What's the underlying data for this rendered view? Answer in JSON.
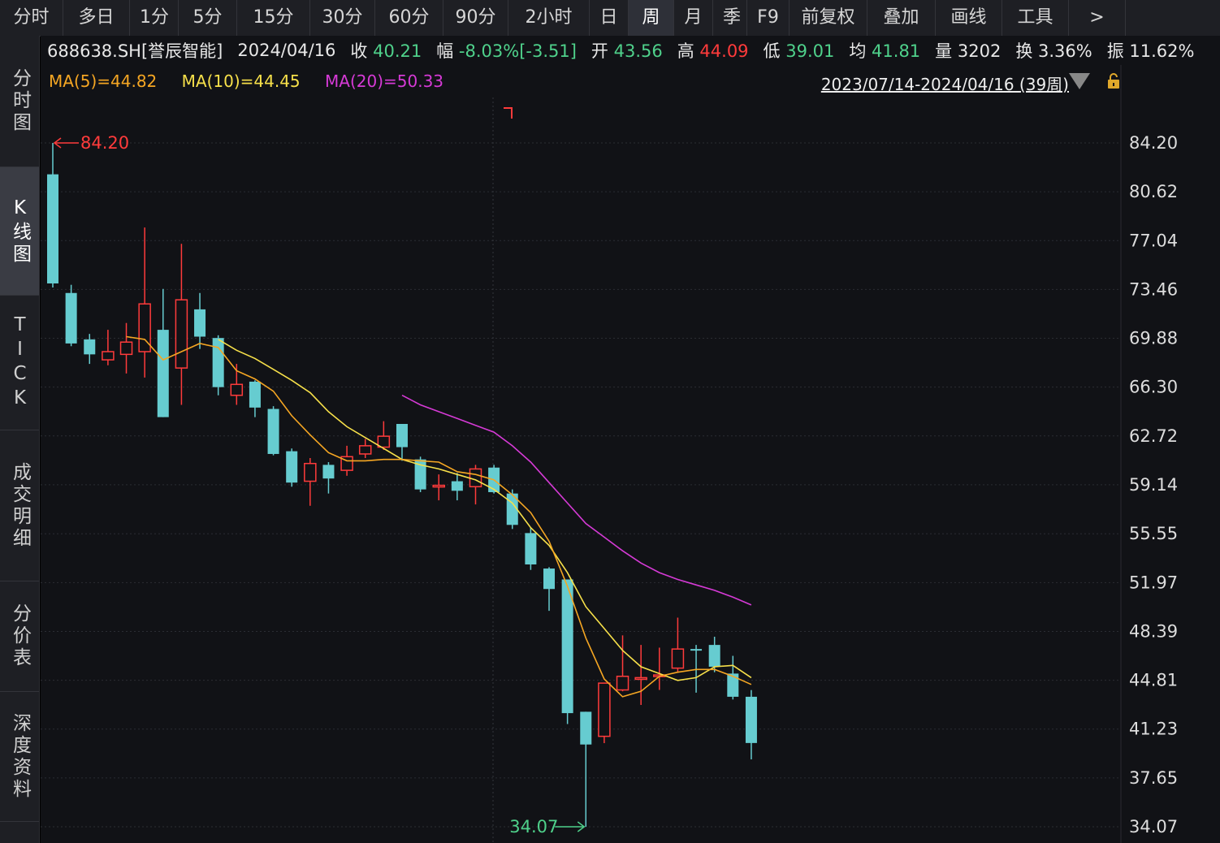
{
  "toolbar": {
    "tabs": [
      "分时",
      "多日",
      "1分",
      "5分",
      "15分",
      "30分",
      "60分",
      "90分",
      "2小时",
      "日",
      "周",
      "月",
      "季",
      "F9",
      "前复权",
      "叠加",
      "画线",
      "工具",
      ">"
    ],
    "active": "周"
  },
  "sidebar": {
    "items": [
      {
        "label": "分时图"
      },
      {
        "label": "K线图"
      },
      {
        "label": "TICK"
      },
      {
        "label": "成交明细"
      },
      {
        "label": "分价表"
      },
      {
        "label": "深度资料"
      }
    ],
    "active_index": 1
  },
  "info": {
    "symbol": "688638.SH[誉辰智能]",
    "date": "2024/04/16",
    "close_label": "收",
    "close": "40.21",
    "change_label": "幅",
    "change": "-8.03%[-3.51]",
    "open_label": "开",
    "open": "43.56",
    "high_label": "高",
    "high": "44.09",
    "low_label": "低",
    "low": "39.01",
    "avg_label": "均",
    "avg": "41.81",
    "vol_label": "量",
    "vol": "3202",
    "turnover_label": "换",
    "turnover": "3.36%",
    "amp_label": "振",
    "amp": "11.62%"
  },
  "ma": {
    "ma5": "MA(5)=44.82",
    "ma10": "MA(10)=44.45",
    "ma20": "MA(20)=50.33"
  },
  "range_label": "2023/07/14-2024/04/16 (39周)",
  "colors": {
    "up": "#ff3b3b",
    "down": "#66ccd0",
    "ma5": "#f5a623",
    "ma10": "#f7e04a",
    "ma20": "#d63ad6",
    "axis_text": "#dddddd",
    "grid": "#2b2d33"
  },
  "chart_data": {
    "type": "candlestick",
    "y_ticks": [
      "84.20",
      "80.62",
      "77.04",
      "73.46",
      "69.88",
      "66.30",
      "62.72",
      "59.14",
      "55.55",
      "51.97",
      "48.39",
      "44.81",
      "41.23",
      "37.65",
      "34.07"
    ],
    "ylim": [
      34.07,
      84.2
    ],
    "max_label": "84.20",
    "min_label": "34.07",
    "candles": [
      {
        "o": 81.9,
        "c": 73.9,
        "h": 84.2,
        "l": 73.6
      },
      {
        "o": 73.2,
        "c": 69.5,
        "h": 73.8,
        "l": 69.3
      },
      {
        "o": 69.8,
        "c": 68.7,
        "h": 70.2,
        "l": 68.0
      },
      {
        "o": 68.3,
        "c": 68.9,
        "h": 70.5,
        "l": 67.9
      },
      {
        "o": 68.7,
        "c": 69.6,
        "h": 71.0,
        "l": 67.3
      },
      {
        "o": 68.9,
        "c": 72.4,
        "h": 78.0,
        "l": 67.0
      },
      {
        "o": 70.5,
        "c": 64.1,
        "h": 73.5,
        "l": 64.1
      },
      {
        "o": 67.7,
        "c": 72.7,
        "h": 76.8,
        "l": 65.0
      },
      {
        "o": 72.0,
        "c": 70.0,
        "h": 73.2,
        "l": 69.1
      },
      {
        "o": 69.9,
        "c": 66.3,
        "h": 70.1,
        "l": 65.7
      },
      {
        "o": 65.7,
        "c": 66.5,
        "h": 68.0,
        "l": 65.0
      },
      {
        "o": 66.7,
        "c": 64.8,
        "h": 66.8,
        "l": 64.1
      },
      {
        "o": 64.7,
        "c": 61.4,
        "h": 64.9,
        "l": 61.3
      },
      {
        "o": 61.6,
        "c": 59.3,
        "h": 61.8,
        "l": 59.0
      },
      {
        "o": 59.4,
        "c": 60.7,
        "h": 61.1,
        "l": 57.6
      },
      {
        "o": 60.6,
        "c": 59.6,
        "h": 60.8,
        "l": 58.5
      },
      {
        "o": 60.2,
        "c": 61.2,
        "h": 62.0,
        "l": 59.8
      },
      {
        "o": 61.4,
        "c": 62.0,
        "h": 62.5,
        "l": 61.1
      },
      {
        "o": 61.9,
        "c": 62.7,
        "h": 63.8,
        "l": 61.7
      },
      {
        "o": 63.6,
        "c": 61.9,
        "h": 63.6,
        "l": 60.9
      },
      {
        "o": 61.0,
        "c": 58.8,
        "h": 61.2,
        "l": 58.6
      },
      {
        "o": 59.0,
        "c": 59.1,
        "h": 59.9,
        "l": 58.0
      },
      {
        "o": 59.4,
        "c": 58.7,
        "h": 60.0,
        "l": 58.0
      },
      {
        "o": 59.0,
        "c": 60.3,
        "h": 60.6,
        "l": 57.7
      },
      {
        "o": 60.4,
        "c": 58.6,
        "h": 60.6,
        "l": 58.5
      },
      {
        "o": 58.5,
        "c": 56.2,
        "h": 58.8,
        "l": 55.9
      },
      {
        "o": 55.6,
        "c": 53.3,
        "h": 56.0,
        "l": 52.9
      },
      {
        "o": 53.0,
        "c": 51.5,
        "h": 53.1,
        "l": 49.9
      },
      {
        "o": 52.2,
        "c": 42.4,
        "h": 52.2,
        "l": 41.6
      },
      {
        "o": 42.5,
        "c": 40.1,
        "h": 42.5,
        "l": 34.07
      },
      {
        "o": 40.7,
        "c": 44.6,
        "h": 44.6,
        "l": 40.2
      },
      {
        "o": 44.1,
        "c": 45.1,
        "h": 48.1,
        "l": 44.0
      },
      {
        "o": 45.0,
        "c": 45.0,
        "h": 47.4,
        "l": 43.0
      },
      {
        "o": 45.1,
        "c": 45.2,
        "h": 47.2,
        "l": 44.1
      },
      {
        "o": 45.7,
        "c": 47.1,
        "h": 49.4,
        "l": 45.4
      },
      {
        "o": 47.1,
        "c": 47.0,
        "h": 47.4,
        "l": 43.9
      },
      {
        "o": 47.4,
        "c": 45.8,
        "h": 48.0,
        "l": 45.4
      },
      {
        "o": 45.3,
        "c": 43.6,
        "h": 46.6,
        "l": 43.4
      },
      {
        "o": 43.6,
        "c": 40.21,
        "h": 44.09,
        "l": 39.01
      }
    ],
    "ma5": [
      null,
      null,
      null,
      null,
      70.0,
      69.8,
      68.3,
      68.9,
      69.5,
      69.2,
      67.5,
      66.9,
      66.0,
      64.2,
      62.8,
      61.5,
      60.9,
      60.9,
      61.0,
      61.0,
      60.9,
      60.8,
      60.1,
      59.9,
      59.5,
      58.4,
      57.1,
      55.0,
      51.7,
      47.9,
      44.9,
      43.6,
      44.0,
      45.1,
      45.4,
      45.6,
      45.6,
      45.1,
      44.5
    ],
    "ma10": [
      null,
      null,
      null,
      null,
      null,
      null,
      null,
      null,
      null,
      69.8,
      69.0,
      68.4,
      67.6,
      66.8,
      65.9,
      64.5,
      63.4,
      62.6,
      61.8,
      61.0,
      60.6,
      60.3,
      59.9,
      59.5,
      58.8,
      57.8,
      56.0,
      54.7,
      52.7,
      50.2,
      48.6,
      47.0,
      45.8,
      45.3,
      44.8,
      45.0,
      45.8,
      45.9,
      45.0
    ],
    "ma20": [
      null,
      null,
      null,
      null,
      null,
      null,
      null,
      null,
      null,
      null,
      null,
      null,
      null,
      null,
      null,
      null,
      null,
      null,
      null,
      65.7,
      65.0,
      64.5,
      64.0,
      63.5,
      63.0,
      62.0,
      60.8,
      59.3,
      57.8,
      56.3,
      55.3,
      54.3,
      53.4,
      52.7,
      52.2,
      51.8,
      51.4,
      50.9,
      50.33
    ]
  }
}
